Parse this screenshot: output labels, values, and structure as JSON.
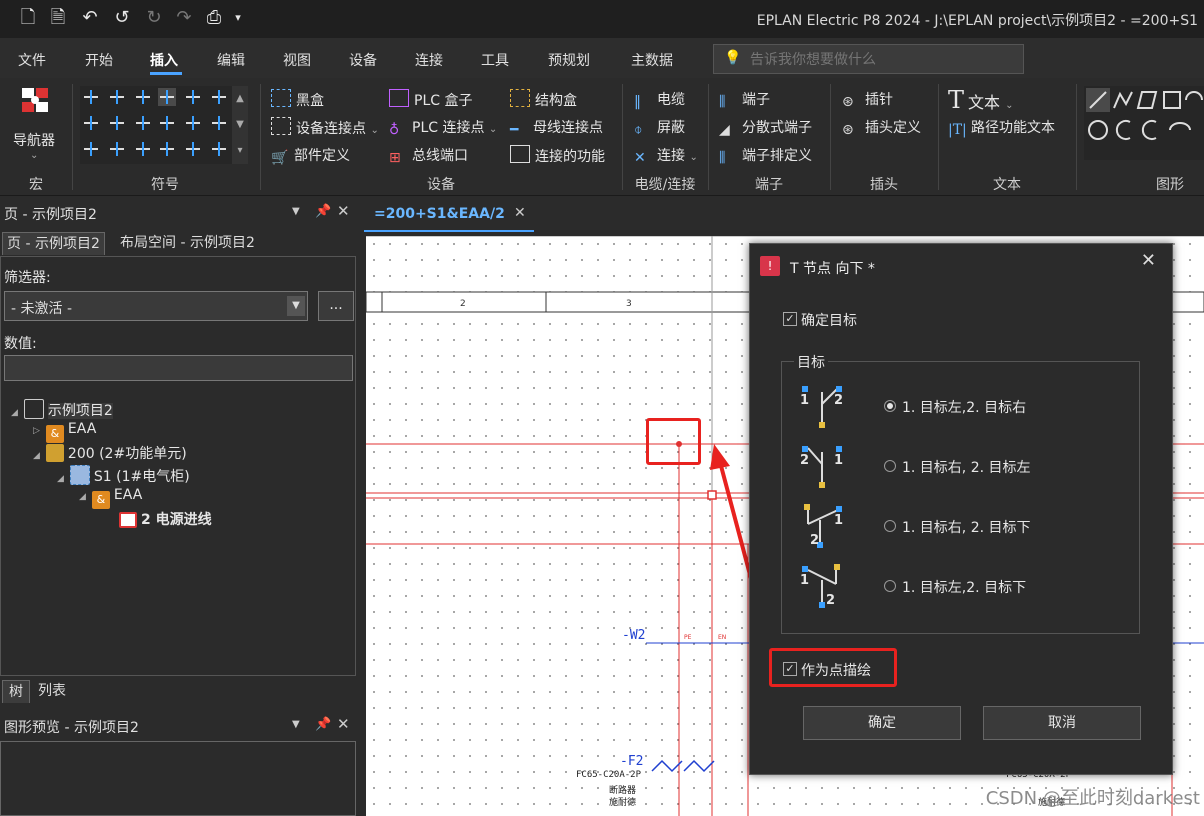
{
  "window": {
    "title": "EPLAN Electric P8 2024 - J:\\EPLAN project\\示例项目2 - =200+S1"
  },
  "menu": {
    "items": [
      "文件",
      "开始",
      "插入",
      "编辑",
      "视图",
      "设备",
      "连接",
      "工具",
      "预规划",
      "主数据"
    ],
    "active": "插入",
    "search_placeholder": "告诉我你想要做什么"
  },
  "ribbon": {
    "macro": {
      "navigator_label": "导航器",
      "group_label": "宏"
    },
    "symbol": {
      "group_label": "符号"
    },
    "device": {
      "group_label": "设备",
      "items": [
        "黑盒",
        "设备连接点",
        "部件定义",
        "PLC 盒子",
        "PLC 连接点",
        "总线端口",
        "结构盒",
        "母线连接点",
        "连接的功能"
      ]
    },
    "cable": {
      "group_label": "电缆/连接",
      "items": [
        "电缆",
        "屏蔽",
        "连接"
      ]
    },
    "terminal": {
      "group_label": "端子",
      "items": [
        "端子",
        "分散式端子",
        "端子排定义"
      ]
    },
    "plug": {
      "group_label": "插头",
      "items": [
        "插针",
        "插头定义"
      ]
    },
    "text": {
      "group_label": "文本",
      "items": [
        "文本",
        "路径功能文本"
      ]
    },
    "graphic": {
      "group_label": "图形"
    }
  },
  "left_panel": {
    "title": "页 - 示例项目2",
    "tabs": [
      "页 - 示例项目2",
      "布局空间 - 示例项目2"
    ],
    "filter_label": "筛选器:",
    "filter_value": "- 未激活 -",
    "filter_more": "...",
    "value_label": "数值:",
    "tree": [
      {
        "label": "示例项目2"
      },
      {
        "label": "EAA"
      },
      {
        "label": "200 (2#功能单元)"
      },
      {
        "label": "S1 (1#电气柜)"
      },
      {
        "label": "EAA"
      },
      {
        "label": "2 电源进线"
      }
    ],
    "bottom_tabs": [
      "树",
      "列表"
    ],
    "preview_title": "图形预览 - 示例项目2"
  },
  "document": {
    "tab_label": "=200+S1&EAA/2",
    "col_numbers": [
      "2",
      "3"
    ],
    "labels": {
      "w2": "-W2",
      "f2": "-F2",
      "pe": "PE",
      "en": "EN",
      "breaker_model": "FC65-C20A-2P",
      "breaker_name": "断路器",
      "breaker_maker": "施耐德",
      "breaker_model_right": "FC65-C20A-2P",
      "breaker_maker_right": "施耐德"
    }
  },
  "dialog": {
    "title": "T 节点 向下 *",
    "confirm_target_label": "确定目标",
    "confirm_target_checked": true,
    "group_label": "目标",
    "options": [
      {
        "label": "1. 目标左,2. 目标右",
        "selected": true,
        "icon": "t-node-left-right-icon",
        "n1": "1",
        "n2": "2"
      },
      {
        "label": "1. 目标右, 2. 目标左",
        "selected": false,
        "icon": "t-node-right-left-icon",
        "n1": "2",
        "n2": "1"
      },
      {
        "label": "1. 目标右, 2. 目标下",
        "selected": false,
        "icon": "t-node-right-down-icon",
        "n1": "1",
        "n2": "2"
      },
      {
        "label": "1. 目标左,2. 目标下",
        "selected": false,
        "icon": "t-node-left-down-icon",
        "n1": "1",
        "n2": "2"
      }
    ],
    "as_point_label": "作为点描绘",
    "as_point_checked": true,
    "ok_label": "确定",
    "cancel_label": "取消"
  },
  "watermark": "CSDN @至此时刻darkest",
  "colors": {
    "accent": "#4aa3ff",
    "annotation": "#e8221f",
    "wire": "#e03030",
    "wire_blue": "#2040d0"
  }
}
